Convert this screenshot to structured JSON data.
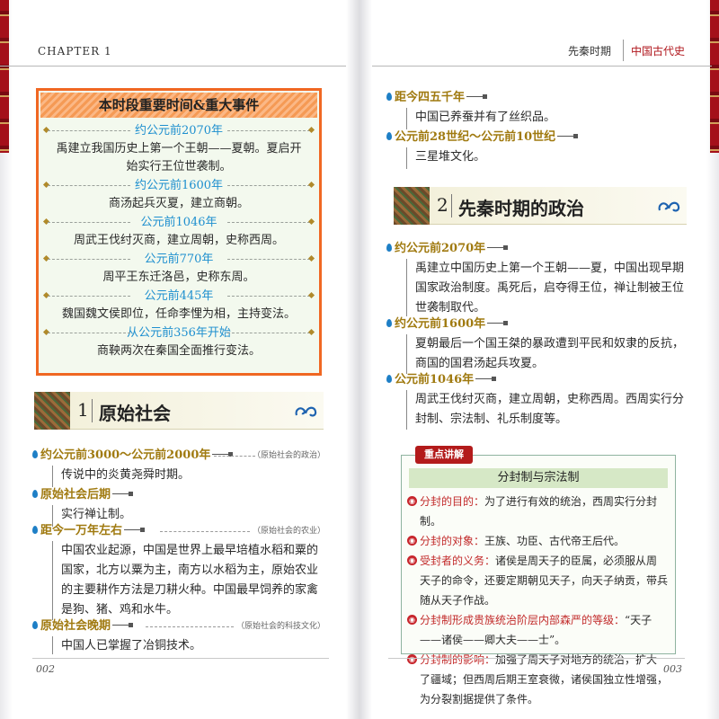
{
  "header": {
    "chapter": "CHAPTER 1",
    "subtitle": "先秦时期",
    "category": "中国古代史"
  },
  "timeline": {
    "title": "本时段重要时间&重大事件",
    "items": [
      {
        "date": "约公元前2070年",
        "desc": "禹建立我国历史上第一个王朝——夏朝。夏启开始实行王位世袭制。"
      },
      {
        "date": "约公元前1600年",
        "desc": "商汤起兵灭夏，建立商朝。"
      },
      {
        "date": "公元前1046年",
        "desc": "周武王伐纣灭商，建立周朝，史称西周。"
      },
      {
        "date": "公元前770年",
        "desc": "周平王东迁洛邑，史称东周。"
      },
      {
        "date": "公元前445年",
        "desc": "魏国魏文侯即位，任命李悝为相，主持变法。"
      },
      {
        "date": "从公元前356年开始",
        "desc": "商鞅两次在秦国全面推行变法。"
      }
    ]
  },
  "section1": {
    "num": "1",
    "title": "原始社会",
    "entries": [
      {
        "title": "约公元前3000～公元前2000年",
        "tag": "（原始社会的政治）",
        "body": "传说中的炎黄尧舜时期。"
      },
      {
        "title": "原始社会后期",
        "tag": "",
        "body": "实行禅让制。"
      },
      {
        "title": "距今一万年左右",
        "tag": "（原始社会的农业）",
        "body": "中国农业起源，中国是世界上最早培植水稻和粟的国家，北方以粟为主，南方以水稻为主，原始农业的主要耕作方法是刀耕火种。中国最早饲养的家禽是狗、猪、鸡和水牛。"
      },
      {
        "title": "原始社会晚期",
        "tag": "（原始社会的科技文化）",
        "body": "中国人已掌握了冶铜技术。"
      }
    ]
  },
  "right_top": {
    "entries": [
      {
        "title": "距今四五千年",
        "body": "中国已养蚕并有了丝织品。"
      },
      {
        "title": "公元前28世纪～公元前10世纪",
        "body": "三星堆文化。"
      }
    ]
  },
  "section2": {
    "num": "2",
    "title": "先秦时期的政治",
    "entries": [
      {
        "title": "约公元前2070年",
        "body": "禹建立中国历史上第一个王朝——夏，中国出现早期国家政治制度。禹死后，启夺得王位，禅让制被王位世袭制取代。"
      },
      {
        "title": "约公元前1600年",
        "body": "夏朝最后一个国王桀的暴政遭到平民和奴隶的反抗，商国的国君汤起兵攻夏。"
      },
      {
        "title": "公元前1046年",
        "body": "周武王伐纣灭商，建立周朝，史称西周。西周实行分封制、宗法制、礼乐制度等。"
      }
    ]
  },
  "keypoints": {
    "label": "重点讲解",
    "title": "分封制与宗法制",
    "items": [
      {
        "key": "分封的目的：",
        "text": "为了进行有效的统治，西周实行分封制。"
      },
      {
        "key": "分封的对象：",
        "text": "王族、功臣、古代帝王后代。"
      },
      {
        "key": "受封者的义务：",
        "text": "诸侯是周天子的臣属，必须服从周天子的命令，还要定期朝见天子，向天子纳贡，带兵随从天子作战。"
      },
      {
        "key": "分封制形成贵族统治阶层内部森严的等级：",
        "text": "“天子——诸侯——卿大夫——士”。"
      },
      {
        "key": "分封制的影响：",
        "text": "加强了周天子对地方的统治，扩大了疆域；但西周后期王室衰微，诸侯国独立性增强，为分裂割据提供了条件。"
      }
    ]
  },
  "folio": {
    "left": "002",
    "right": "003"
  },
  "colors": {
    "accent_orange": "#f06722",
    "date_blue": "#1e8fcf",
    "title_gold": "#a07a10",
    "key_red": "#c22a2a"
  }
}
